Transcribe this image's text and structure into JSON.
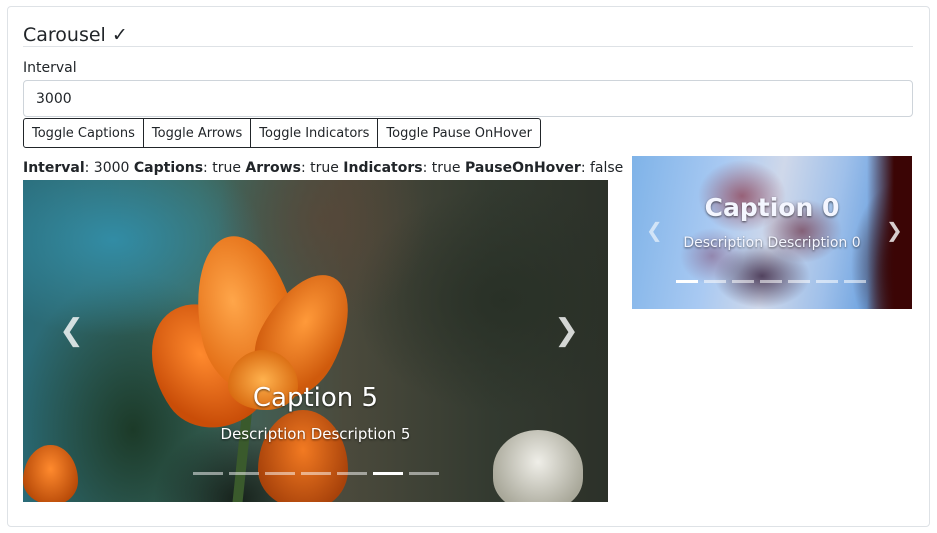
{
  "section": {
    "title": "Carousel ✓"
  },
  "interval": {
    "label": "Interval",
    "value": "3000"
  },
  "toggles": [
    {
      "label": "Toggle Captions"
    },
    {
      "label": "Toggle Arrows"
    },
    {
      "label": "Toggle Indicators"
    },
    {
      "label": "Toggle Pause OnHover"
    }
  ],
  "status": {
    "interval_key": "Interval",
    "interval_value": ": 3000 ",
    "captions_key": "Captions",
    "captions_value": ": true ",
    "arrows_key": "Arrows",
    "arrows_value": ": true ",
    "indicators_key": "Indicators",
    "indicators_value": ": true ",
    "pause_key": "PauseOnHover",
    "pause_value": ": false"
  },
  "main_carousel": {
    "caption_title": "Caption 5",
    "caption_description": "Description Description 5",
    "prev_icon": "chevron-left-icon",
    "next_icon": "chevron-right-icon",
    "slide_count": 7,
    "active_index": 5
  },
  "second_carousel": {
    "caption_title": "Caption 0",
    "caption_description": "Description Description 0",
    "prev_icon": "chevron-left-icon",
    "next_icon": "chevron-right-icon",
    "slide_count": 7,
    "active_index": 0
  },
  "colors": {
    "border": "#dee2e6",
    "text": "#212529",
    "indicator_active": "#ffffff",
    "indicator_inactive": "rgba(255,255,255,0.5)"
  }
}
